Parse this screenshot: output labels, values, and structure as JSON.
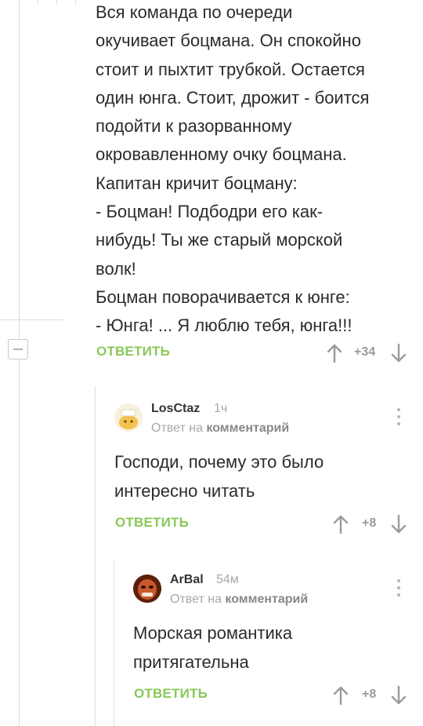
{
  "story": {
    "text": "Вся команда по очереди\nокучивает боцмана. Он спокойно\nстоит и пыхтит трубкой. Остается\nодин юнга. Стоит, дрожит - боится\nподойти к разорванному\nокровавленному очку боцмана.\nКапитан кричит боцману:\n- Боцман! Подбодри его как-\nнибудь! Ты же старый морской\nволк!\nБоцман поворачивается к юнге:\n- Юнга! ... Я люблю тебя, юнга!!!",
    "reply_label": "ОТВЕТИТЬ",
    "rating": "+34"
  },
  "comments": [
    {
      "username": "LosCtaz",
      "time": "1ч",
      "reply_prefix": "Ответ на",
      "reply_target": "комментарий",
      "text": "Господи, почему это было\nинтересно читать",
      "reply_label": "ОТВЕТИТЬ",
      "rating": "+8"
    },
    {
      "username": "ArBal",
      "time": "54м",
      "reply_prefix": "Ответ на",
      "reply_target": "комментарий",
      "text": "Морская романтика\nпритягательна",
      "reply_label": "ОТВЕТИТЬ",
      "rating": "+8"
    }
  ],
  "colors": {
    "accent": "#8ac858",
    "muted": "#a8a8a8",
    "line": "#dcdcdc"
  },
  "icons": [
    "collapse-minus-icon",
    "arrow-up-icon",
    "arrow-down-icon",
    "more-vertical-icon"
  ]
}
